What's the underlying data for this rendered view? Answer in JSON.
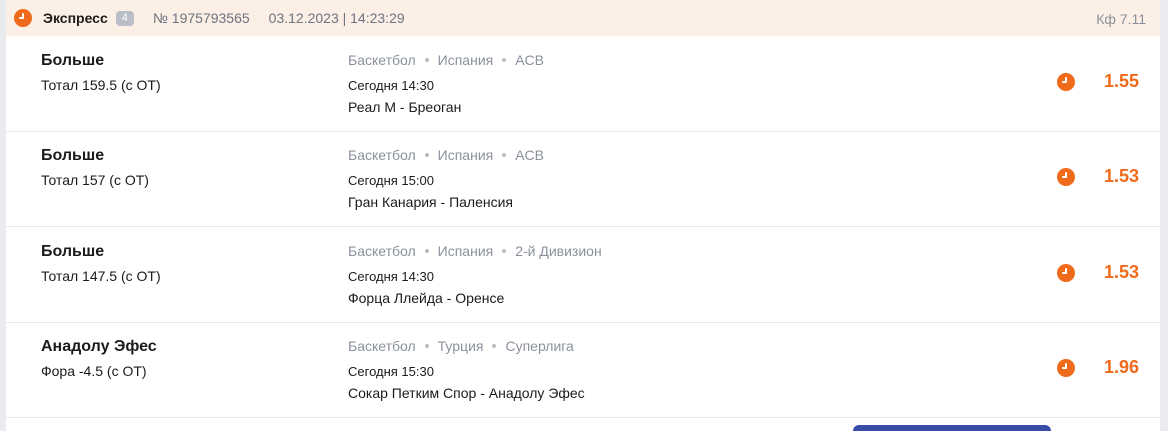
{
  "header": {
    "type_label": "Экспресс",
    "count": "4",
    "bet_number": "№ 1975793565",
    "datetime": "03.12.2023 | 14:23:29",
    "total_coef": "Кф 7.11"
  },
  "events": [
    {
      "pick": "Больше",
      "market": "Тотал 159.5 (с ОТ)",
      "sport": "Баскетбол",
      "country": "Испания",
      "league": "ACB",
      "time": "Сегодня 14:30",
      "match": "Реал М - Бреоган",
      "odds": "1.55"
    },
    {
      "pick": "Больше",
      "market": "Тотал 157 (с ОТ)",
      "sport": "Баскетбол",
      "country": "Испания",
      "league": "ACB",
      "time": "Сегодня 15:00",
      "match": "Гран Канария - Паленсия",
      "odds": "1.53"
    },
    {
      "pick": "Больше",
      "market": "Тотал 147.5 (с ОТ)",
      "sport": "Баскетбол",
      "country": "Испания",
      "league": "2-й Дивизион",
      "time": "Сегодня 14:30",
      "match": "Форца Ллейда - Оренсе",
      "odds": "1.53"
    },
    {
      "pick": "Анадолу Эфес",
      "market": "Фора -4.5 (с ОТ)",
      "sport": "Баскетбол",
      "country": "Турция",
      "league": "Суперлига",
      "time": "Сегодня 15:30",
      "match": "Сокар Петким Спор - Анадолу Эфес",
      "odds": "1.96"
    }
  ],
  "icons": {
    "status": "clock-icon"
  },
  "colors": {
    "accent": "#f06a1c",
    "header_bg": "#fcefe6",
    "muted": "#8b919c",
    "button": "#3b4ca8"
  }
}
